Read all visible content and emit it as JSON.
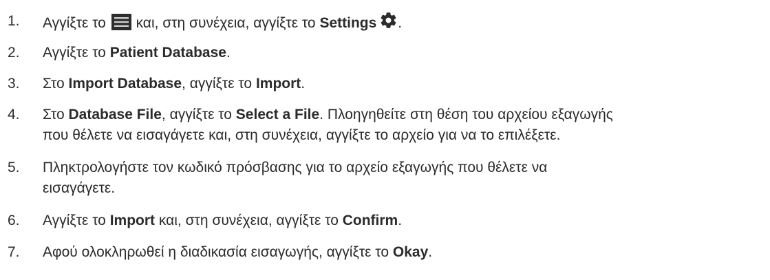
{
  "steps": [
    {
      "number": "1.",
      "text_before": "Αγγίξτε το",
      "menu_icon": "menu-icon",
      "text_middle": "και, στη συνέχεια, αγγίξτε το",
      "bold": "Settings",
      "settings_icon": "gear-icon",
      "text_after": "."
    },
    {
      "number": "2.",
      "text_before": "Αγγίξτε το ",
      "bold": "Patient Database",
      "text_after": "."
    },
    {
      "number": "3.",
      "text_before": "Στο ",
      "bold_1": "Import Database",
      "text_middle": ", αγγίξτε το ",
      "bold_2": "Import",
      "text_after": "."
    },
    {
      "number": "4.",
      "text_before": "Στο ",
      "bold_1": "Database File",
      "text_middle": ", αγγίξτε το ",
      "bold_2": "Select a File",
      "text_after": ". Πλοηγηθείτε στη θέση του αρχείου εξαγωγής",
      "line_2": "που θέλετε να εισαγάγετε και, στη συνέχεια, αγγίξτε το αρχείο για να το επιλέξετε."
    },
    {
      "number": "5.",
      "line_1": "Πληκτρολογήστε τον κωδικό πρόσβασης για το αρχείο εξαγωγής που θέλετε να",
      "line_2": "εισαγάγετε."
    },
    {
      "number": "6.",
      "text_before": "Αγγίξτε το ",
      "bold_1": "Import",
      "text_middle": " και, στη συνέχεια, αγγίξτε το ",
      "bold_2": "Confirm",
      "text_after": "."
    },
    {
      "number": "7.",
      "text_before": "Αφού ολοκληρωθεί η διαδικασία εισαγωγής, αγγίξτε το ",
      "bold": "Okay",
      "text_after": "."
    }
  ]
}
